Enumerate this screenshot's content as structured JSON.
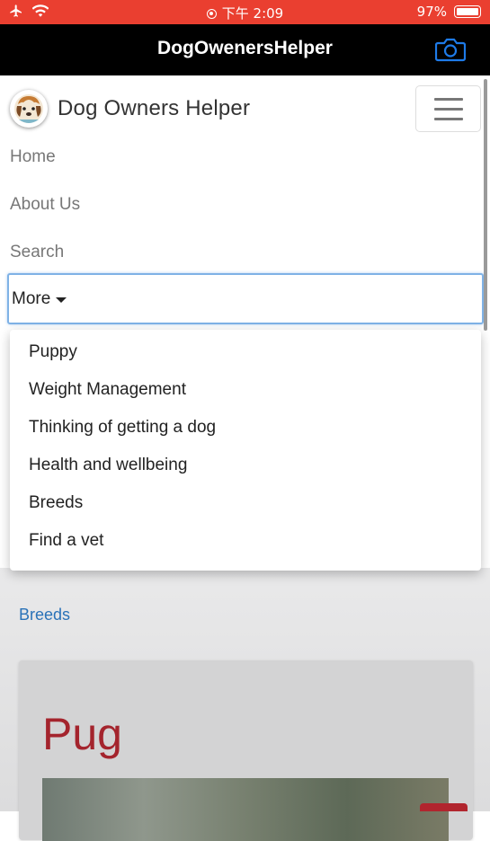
{
  "status_bar": {
    "carrier_icons": [
      "airplane-icon",
      "wifi-icon"
    ],
    "center_text": "下午 2:09",
    "battery_percent": "97%"
  },
  "app_bar": {
    "title": "DogOwenersHelper",
    "camera_icon": "camera-icon"
  },
  "navbar": {
    "brand": "Dog Owners Helper",
    "links": [
      "Home",
      "About Us",
      "Search"
    ],
    "more_label": "More",
    "dropdown_items": [
      "Puppy",
      "Weight Management",
      "Thinking of getting a dog",
      "Health and wellbeing",
      "Breeds",
      "Find a vet"
    ]
  },
  "content": {
    "breadcrumb": "Breeds",
    "card_title": "Pug"
  },
  "colors": {
    "status_bar": "#ea3f30",
    "app_bar": "#000000",
    "camera_icon": "#1e7be9",
    "link": "#2a72b8",
    "card_title": "#a4242d"
  }
}
